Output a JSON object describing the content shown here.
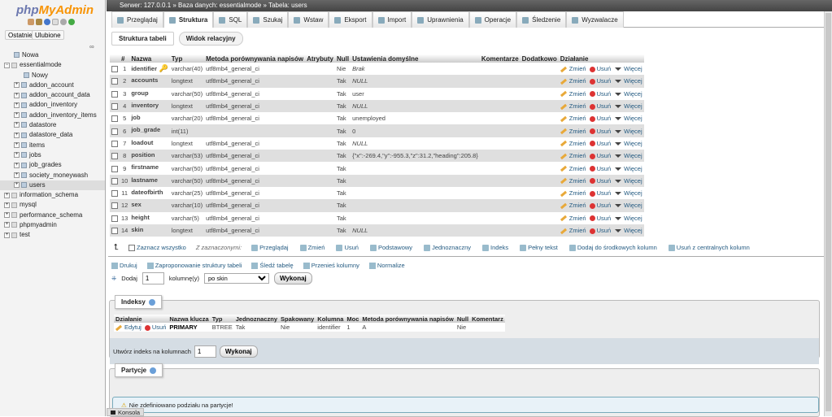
{
  "sidebar": {
    "logo_a": "php",
    "logo_b": "MyAdmin",
    "recent": "Ostatnie",
    "favorites": "Ulubione",
    "tree": [
      {
        "label": "Nowa",
        "level": 1,
        "kind": "new"
      },
      {
        "label": "essentialmode",
        "level": 0,
        "kind": "db",
        "open": true
      },
      {
        "label": "Nowy",
        "level": 2,
        "kind": "new"
      },
      {
        "label": "addon_account",
        "level": 1,
        "kind": "table"
      },
      {
        "label": "addon_account_data",
        "level": 1,
        "kind": "table"
      },
      {
        "label": "addon_inventory",
        "level": 1,
        "kind": "table"
      },
      {
        "label": "addon_inventory_items",
        "level": 1,
        "kind": "table"
      },
      {
        "label": "datastore",
        "level": 1,
        "kind": "table"
      },
      {
        "label": "datastore_data",
        "level": 1,
        "kind": "table"
      },
      {
        "label": "items",
        "level": 1,
        "kind": "table"
      },
      {
        "label": "jobs",
        "level": 1,
        "kind": "table"
      },
      {
        "label": "job_grades",
        "level": 1,
        "kind": "table"
      },
      {
        "label": "society_moneywash",
        "level": 1,
        "kind": "table"
      },
      {
        "label": "users",
        "level": 1,
        "kind": "table",
        "selected": true
      },
      {
        "label": "information_schema",
        "level": 0,
        "kind": "db"
      },
      {
        "label": "mysql",
        "level": 0,
        "kind": "db"
      },
      {
        "label": "performance_schema",
        "level": 0,
        "kind": "db"
      },
      {
        "label": "phpmyadmin",
        "level": 0,
        "kind": "db"
      },
      {
        "label": "test",
        "level": 0,
        "kind": "db"
      }
    ]
  },
  "breadcrumb": "Serwer: 127.0.0.1 » Baza danych: essentialmode » Tabela: users",
  "tabs": [
    "Przeglądaj",
    "Struktura",
    "SQL",
    "Szukaj",
    "Wstaw",
    "Eksport",
    "Import",
    "Uprawnienia",
    "Operacje",
    "Śledzenie",
    "Wyzwalacze"
  ],
  "active_tab": "Struktura",
  "subtabs": [
    "Struktura tabeli",
    "Widok relacyjny"
  ],
  "columns_header": [
    "#",
    "Nazwa",
    "Typ",
    "Metoda porównywania napisów",
    "Atrybuty",
    "Null",
    "Ustawienia domyślne",
    "Komentarze",
    "Dodatkowo",
    "Działanie"
  ],
  "columns": [
    [
      "1",
      "identifier",
      "varchar(40)",
      "utf8mb4_general_ci",
      "",
      "Nie",
      "Brak"
    ],
    [
      "2",
      "accounts",
      "longtext",
      "utf8mb4_general_ci",
      "",
      "Tak",
      "NULL"
    ],
    [
      "3",
      "group",
      "varchar(50)",
      "utf8mb4_general_ci",
      "",
      "Tak",
      "user"
    ],
    [
      "4",
      "inventory",
      "longtext",
      "utf8mb4_general_ci",
      "",
      "Tak",
      "NULL"
    ],
    [
      "5",
      "job",
      "varchar(20)",
      "utf8mb4_general_ci",
      "",
      "Tak",
      "unemployed"
    ],
    [
      "6",
      "job_grade",
      "int(11)",
      "",
      "",
      "Tak",
      "0"
    ],
    [
      "7",
      "loadout",
      "longtext",
      "utf8mb4_general_ci",
      "",
      "Tak",
      "NULL"
    ],
    [
      "8",
      "position",
      "varchar(53)",
      "utf8mb4_general_ci",
      "",
      "Tak",
      "{\"x\":-269.4,\"y\":-955.3,\"z\":31.2,\"heading\":205.8}"
    ],
    [
      "9",
      "firstname",
      "varchar(50)",
      "utf8mb4_general_ci",
      "",
      "Tak",
      ""
    ],
    [
      "10",
      "lastname",
      "varchar(50)",
      "utf8mb4_general_ci",
      "",
      "Tak",
      ""
    ],
    [
      "11",
      "dateofbirth",
      "varchar(25)",
      "utf8mb4_general_ci",
      "",
      "Tak",
      ""
    ],
    [
      "12",
      "sex",
      "varchar(10)",
      "utf8mb4_general_ci",
      "",
      "Tak",
      ""
    ],
    [
      "13",
      "height",
      "varchar(5)",
      "utf8mb4_general_ci",
      "",
      "Tak",
      ""
    ],
    [
      "14",
      "skin",
      "longtext",
      "utf8mb4_general_ci",
      "",
      "Tak",
      "NULL"
    ]
  ],
  "row_actions": {
    "change": "Zmień",
    "drop": "Usuń",
    "more": "Więcej"
  },
  "bulk": {
    "select_all": "Zaznacz wszystko",
    "with_selected": "Z zaznaczonymi:",
    "actions": [
      "Przeglądaj",
      "Zmień",
      "Usuń",
      "Podstawowy",
      "Jednoznaczny",
      "Indeks",
      "Pełny tekst",
      "Dodaj do środkowych kolumn",
      "Usuń z centralnych kolumn"
    ]
  },
  "tools": [
    "Drukuj",
    "Zaproponowanie struktury tabeli",
    "Śledź tabelę",
    "Przenieś kolumny",
    "Normalize"
  ],
  "add": {
    "label": "Dodaj",
    "count": "1",
    "unit": "kolumnę(y)",
    "position": "po skin",
    "go": "Wykonaj"
  },
  "indexes": {
    "title": "Indeksy",
    "header": [
      "Działanie",
      "Nazwa klucza",
      "Typ",
      "Jednoznaczny",
      "Spakowany",
      "Kolumna",
      "Moc",
      "Metoda porównywania napisów",
      "Null",
      "Komentarz"
    ],
    "edit": "Edytuj",
    "drop": "Usuń",
    "row": [
      "PRIMARY",
      "BTREE",
      "Tak",
      "Nie",
      "identifier",
      "1",
      "A",
      "Nie",
      ""
    ],
    "create_label": "Utwórz indeks na kolumnach",
    "create_count": "1",
    "go": "Wykonaj"
  },
  "partitions": {
    "title": "Partycje",
    "message": "Nie zdefiniowano podziału na partycje!"
  },
  "console": "Konsola"
}
